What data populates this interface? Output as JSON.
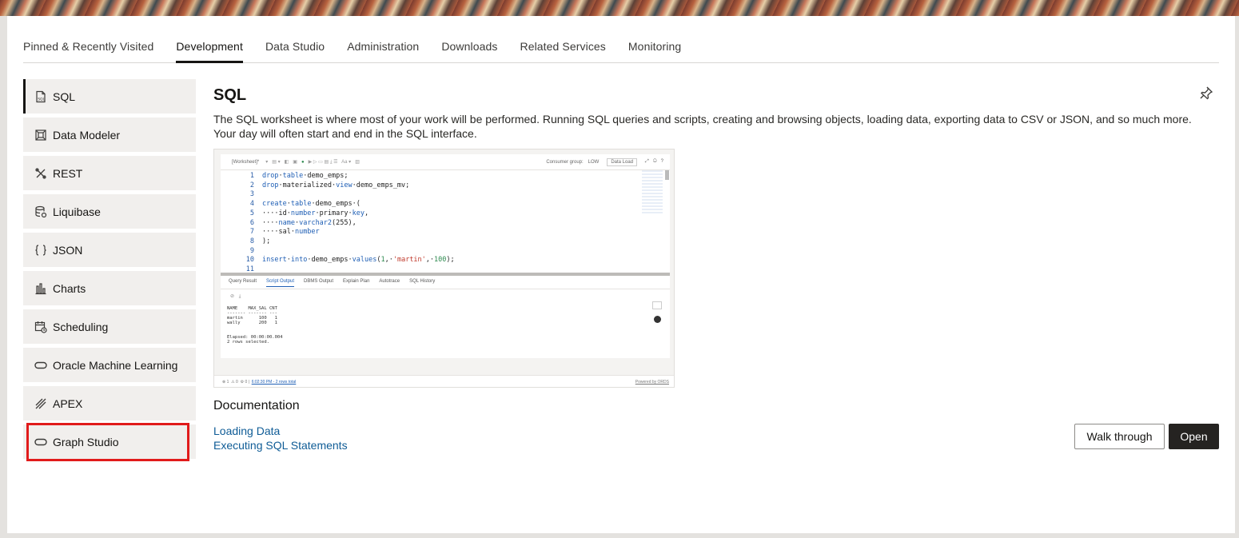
{
  "tabs": [
    {
      "label": "Pinned & Recently Visited",
      "active": false
    },
    {
      "label": "Development",
      "active": true
    },
    {
      "label": "Data Studio",
      "active": false
    },
    {
      "label": "Administration",
      "active": false
    },
    {
      "label": "Downloads",
      "active": false
    },
    {
      "label": "Related Services",
      "active": false
    },
    {
      "label": "Monitoring",
      "active": false
    }
  ],
  "sidebar": {
    "items": [
      {
        "label": "SQL",
        "icon": "sql-file-icon",
        "active": true
      },
      {
        "label": "Data Modeler",
        "icon": "data-modeler-icon",
        "active": false
      },
      {
        "label": "REST",
        "icon": "rest-tools-icon",
        "active": false
      },
      {
        "label": "Liquibase",
        "icon": "liquibase-icon",
        "active": false
      },
      {
        "label": "JSON",
        "icon": "json-braces-icon",
        "active": false
      },
      {
        "label": "Charts",
        "icon": "bar-chart-icon",
        "active": false
      },
      {
        "label": "Scheduling",
        "icon": "calendar-clock-icon",
        "active": false
      },
      {
        "label": "Oracle Machine Learning",
        "icon": "pill-icon",
        "active": false
      },
      {
        "label": "APEX",
        "icon": "apex-icon",
        "active": false
      },
      {
        "label": "Graph Studio",
        "icon": "pill-icon",
        "active": false,
        "highlighted": true
      }
    ],
    "highlight_color": "#e11b1b"
  },
  "main": {
    "title": "SQL",
    "description": "The SQL worksheet is where most of your work will be performed. Running SQL queries and scripts, creating and browsing objects, loading data, exporting data to CSV or JSON, and so much more. Your day will often start and end in the SQL interface.",
    "pin_icon": "pin-icon",
    "preview": {
      "toolbar_left": "[Worksheet]*",
      "consumer_group_label": "Consumer group:",
      "consumer_group_value": "LOW",
      "data_load": "Data Load",
      "code": [
        {
          "n": "1",
          "text": "drop table demo_emps;"
        },
        {
          "n": "2",
          "text": "drop materialized view demo_emps_mv;"
        },
        {
          "n": "3",
          "text": ""
        },
        {
          "n": "4",
          "text": "create table demo_emps ("
        },
        {
          "n": "5",
          "text": "   id number primary key,"
        },
        {
          "n": "6",
          "text": "   name varchar2(255),"
        },
        {
          "n": "7",
          "text": "   sal number"
        },
        {
          "n": "8",
          "text": ");"
        },
        {
          "n": "9",
          "text": ""
        },
        {
          "n": "10",
          "text": "insert into demo_emps values(1, 'martin', 100);"
        },
        {
          "n": "11",
          "text": ""
        }
      ],
      "output_tabs": [
        "Query Result",
        "Script Output",
        "DBMS Output",
        "Explain Plan",
        "Autotrace",
        "SQL History"
      ],
      "output_selected": "Script Output",
      "output_text": "NAME    MAX_SAL CNT\n------- ------- ---\nmartin      100   1\nwally       200   1\n\n\nElapsed: 00:00:00.004\n2 rows selected.",
      "status_text": "6:02:30 PM - 2 rows total",
      "powered_by": "Powered by ORDS"
    },
    "documentation": {
      "heading": "Documentation",
      "links": [
        "Loading Data",
        "Executing SQL Statements"
      ]
    },
    "buttons": {
      "walk_through": "Walk through",
      "open": "Open"
    }
  }
}
